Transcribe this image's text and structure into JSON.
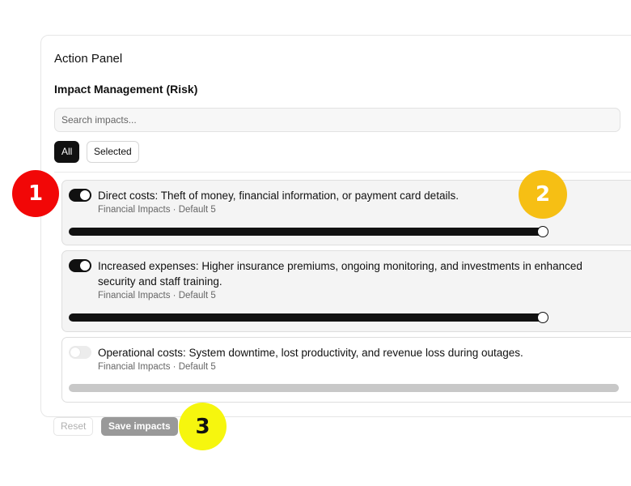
{
  "panel": {
    "title": "Action Panel"
  },
  "section": {
    "title": "Impact Management (Risk)"
  },
  "search": {
    "placeholder": "Search impacts...",
    "value": ""
  },
  "filters": [
    {
      "label": "All",
      "active": true
    },
    {
      "label": "Selected",
      "active": false
    }
  ],
  "impacts": [
    {
      "title": "Direct costs: Theft of money, financial information, or payment card details.",
      "meta": "Financial Impacts · Default 5",
      "enabled": true,
      "value": 5
    },
    {
      "title": "Increased expenses: Higher insurance premiums, ongoing monitoring, and investments in enhanced security and staff training.",
      "meta": "Financial Impacts · Default 5",
      "enabled": true,
      "value": 5
    },
    {
      "title": "Operational costs: System downtime, lost productivity, and revenue loss during outages.",
      "meta": "Financial Impacts · Default 5",
      "enabled": false,
      "value": null
    }
  ],
  "actions": {
    "reset_label": "Reset",
    "save_label": "Save impacts"
  },
  "annotations": [
    {
      "label": "1",
      "color": "#f20707"
    },
    {
      "label": "2",
      "color": "#f6bf14"
    },
    {
      "label": "3",
      "color": "#f6f60e"
    }
  ]
}
